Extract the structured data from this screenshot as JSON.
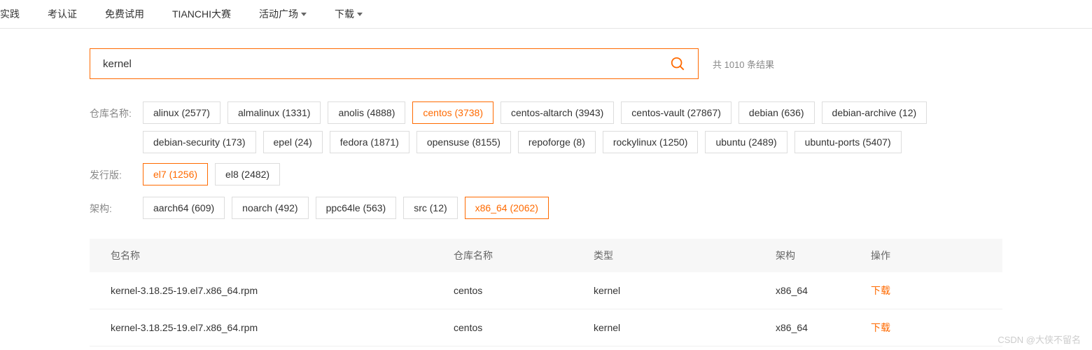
{
  "nav": {
    "items": [
      {
        "label": "实践",
        "dropdown": false
      },
      {
        "label": "考认证",
        "dropdown": false
      },
      {
        "label": "免费试用",
        "dropdown": false
      },
      {
        "label": "TIANCHI大赛",
        "dropdown": false
      },
      {
        "label": "活动广场",
        "dropdown": true
      },
      {
        "label": "下载",
        "dropdown": true
      }
    ]
  },
  "search": {
    "value": "kernel",
    "result_text": "共 1010 条结果"
  },
  "filters": {
    "repo_label": "仓库名称:",
    "dist_label": "发行版:",
    "arch_label": "架构:",
    "repos": [
      {
        "label": "alinux (2577)",
        "active": false
      },
      {
        "label": "almalinux (1331)",
        "active": false
      },
      {
        "label": "anolis (4888)",
        "active": false
      },
      {
        "label": "centos (3738)",
        "active": true
      },
      {
        "label": "centos-altarch (3943)",
        "active": false
      },
      {
        "label": "centos-vault (27867)",
        "active": false
      },
      {
        "label": "debian (636)",
        "active": false
      },
      {
        "label": "debian-archive (12)",
        "active": false
      },
      {
        "label": "debian-security (173)",
        "active": false
      },
      {
        "label": "epel (24)",
        "active": false
      },
      {
        "label": "fedora (1871)",
        "active": false
      },
      {
        "label": "opensuse (8155)",
        "active": false
      },
      {
        "label": "repoforge (8)",
        "active": false
      },
      {
        "label": "rockylinux (1250)",
        "active": false
      },
      {
        "label": "ubuntu (2489)",
        "active": false
      },
      {
        "label": "ubuntu-ports (5407)",
        "active": false
      }
    ],
    "dists": [
      {
        "label": "el7 (1256)",
        "active": true
      },
      {
        "label": "el8 (2482)",
        "active": false
      }
    ],
    "archs": [
      {
        "label": "aarch64 (609)",
        "active": false
      },
      {
        "label": "noarch (492)",
        "active": false
      },
      {
        "label": "ppc64le (563)",
        "active": false
      },
      {
        "label": "src (12)",
        "active": false
      },
      {
        "label": "x86_64 (2062)",
        "active": true
      }
    ]
  },
  "table": {
    "headers": {
      "name": "包名称",
      "repo": "仓库名称",
      "type": "类型",
      "arch": "架构",
      "action": "操作"
    },
    "rows": [
      {
        "name": "kernel-3.18.25-19.el7.x86_64.rpm",
        "repo": "centos",
        "type": "kernel",
        "arch": "x86_64",
        "action": "下载"
      },
      {
        "name": "kernel-3.18.25-19.el7.x86_64.rpm",
        "repo": "centos",
        "type": "kernel",
        "arch": "x86_64",
        "action": "下载"
      }
    ]
  },
  "watermark": "CSDN @大侠不留名"
}
